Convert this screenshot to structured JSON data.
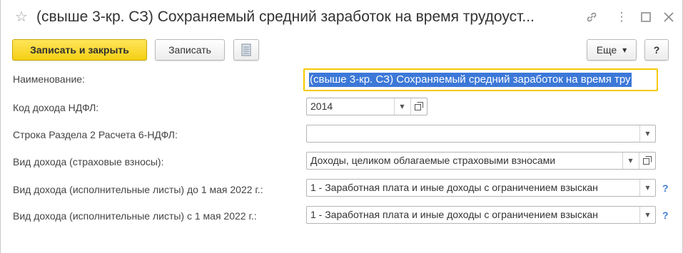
{
  "window": {
    "title": "(свыше 3-кр. СЗ) Сохраняемый средний заработок на время трудоуст...",
    "icons": [
      "star-icon",
      "link-icon",
      "more-icon",
      "maximize-icon",
      "close-icon"
    ]
  },
  "toolbar": {
    "save_close_label": "Записать и закрыть",
    "save_label": "Записать",
    "more_label": "Еще",
    "help_label": "?"
  },
  "form": {
    "name_label": "Наименование:",
    "name_value": "(свыше 3-кр. СЗ) Сохраняемый средний заработок на время тру",
    "ndfl_code_label": "Код дохода НДФЛ:",
    "ndfl_code_value": "2014",
    "section2_label": "Строка Раздела 2 Расчета 6-НДФЛ:",
    "section2_value": "",
    "insurance_label": "Вид дохода (страховые взносы):",
    "insurance_value": "Доходы, целиком облагаемые страховыми взносами",
    "writ_before_label": "Вид дохода (исполнительные листы) до 1 мая 2022 г.:",
    "writ_before_value": "1 - Заработная плата и иные доходы с ограничением взыскан",
    "writ_after_label": "Вид дохода (исполнительные листы) с 1 мая 2022 г.:",
    "writ_after_value": "1 - Заработная плата и иные доходы с ограничением взыскан",
    "help_mark": "?"
  },
  "colors": {
    "primary_button": "#f5cf14",
    "focus_border": "#f6c800",
    "selection": "#3c78d8",
    "help": "#3c7fd0"
  }
}
